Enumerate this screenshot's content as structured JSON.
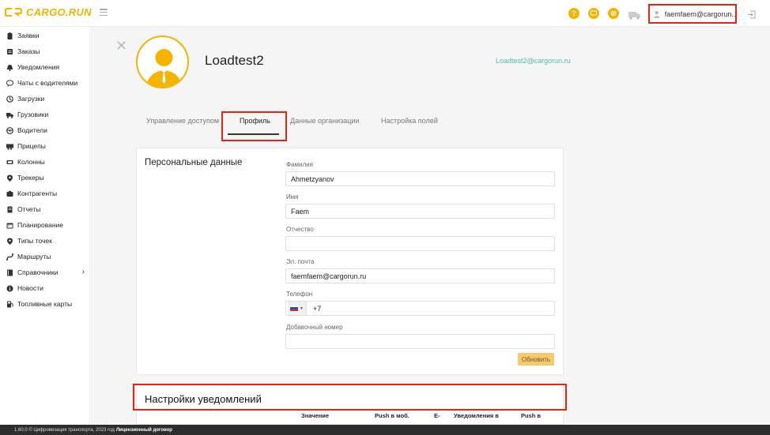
{
  "app": {
    "logo_text": "CARGO.RUN",
    "brand_color": "#f5b400",
    "highlight_color": "#e32515"
  },
  "header": {
    "icons": [
      "help-icon",
      "chat-icon",
      "balance-icon",
      "truck-icon",
      "logout-icon"
    ],
    "user_email": "faemfaem@cargorun..."
  },
  "sidebar": {
    "items": [
      {
        "label": "Заявки",
        "icon": "clipboard-icon"
      },
      {
        "label": "Заказы",
        "icon": "orders-icon"
      },
      {
        "label": "Уведомления",
        "icon": "bell-icon"
      },
      {
        "label": "Чаты с водителями",
        "icon": "chat-icon"
      },
      {
        "label": "Загрузки",
        "icon": "loading-icon"
      },
      {
        "label": "Грузовики",
        "icon": "truck-icon"
      },
      {
        "label": "Водители",
        "icon": "driver-icon"
      },
      {
        "label": "Прицепы",
        "icon": "trailer-icon"
      },
      {
        "label": "Колонны",
        "icon": "convoy-icon"
      },
      {
        "label": "Трекеры",
        "icon": "pin-icon"
      },
      {
        "label": "Контрагенты",
        "icon": "contractors-icon"
      },
      {
        "label": "Отчеты",
        "icon": "reports-icon"
      },
      {
        "label": "Планирование",
        "icon": "calendar-icon"
      },
      {
        "label": "Типы точек",
        "icon": "pin-icon"
      },
      {
        "label": "Маршруты",
        "icon": "route-icon"
      },
      {
        "label": "Справочники",
        "icon": "book-icon"
      },
      {
        "label": "Новости",
        "icon": "info-icon"
      },
      {
        "label": "Топливные карты",
        "icon": "fuel-icon"
      }
    ]
  },
  "profile": {
    "name": "Loadtest2",
    "email": "Loadtest2@cargorun.ru"
  },
  "tabs": [
    {
      "label": "Управление доступом"
    },
    {
      "label": "Профиль",
      "active": true
    },
    {
      "label": "Данные организации"
    },
    {
      "label": "Настройка полей"
    }
  ],
  "personal": {
    "title": "Персональные данные",
    "fields": {
      "last_name": {
        "label": "Фамилия",
        "value": "Ahmetzyanov"
      },
      "first_name": {
        "label": "Имя",
        "value": "Faem"
      },
      "middle_name": {
        "label": "Отчество",
        "value": ""
      },
      "email": {
        "label": "Эл. почта",
        "value": "faemfaem@cargorun.ru"
      },
      "phone": {
        "label": "Телефон",
        "value": "+7"
      },
      "extension": {
        "label": "Добавочный номер",
        "value": ""
      }
    },
    "update_button": "Обновить"
  },
  "notifications": {
    "title": "Настройки уведомлений",
    "columns": [
      "Значение",
      "Push в моб.",
      "E-",
      "Уведомления в",
      "Push в"
    ]
  },
  "footer": {
    "text": "1.60.0 © Цифровизация транспорта, 2023 год",
    "link": "Лицензионный договор"
  }
}
